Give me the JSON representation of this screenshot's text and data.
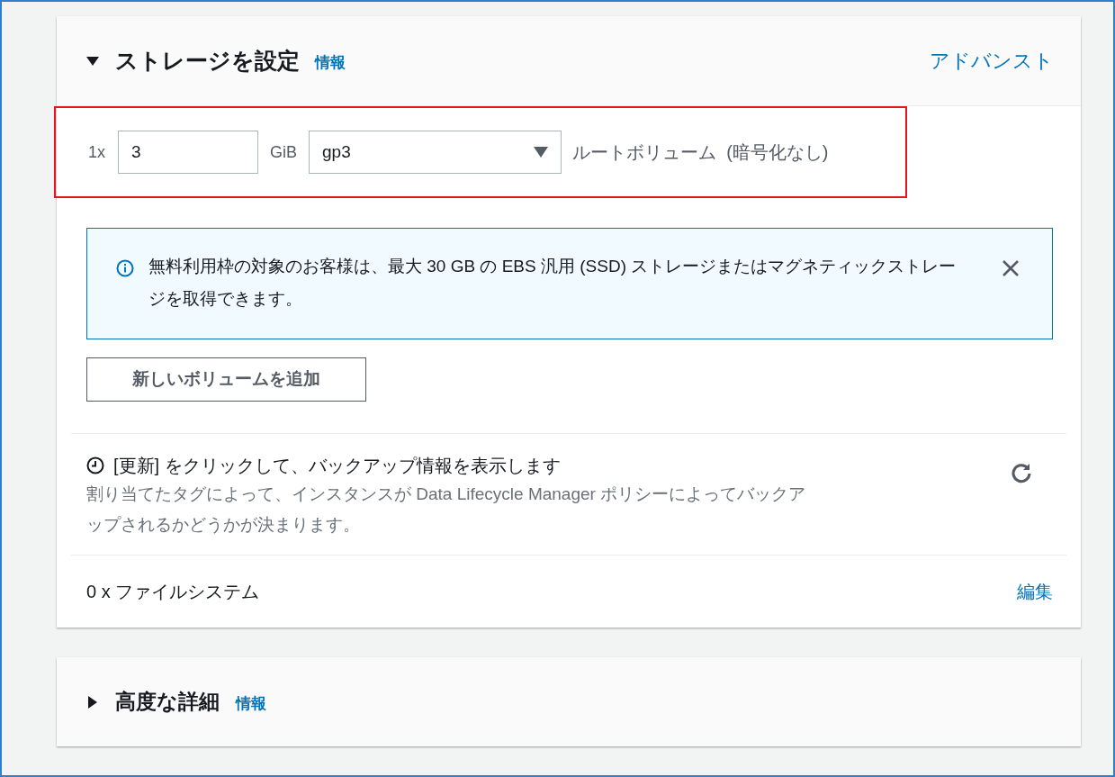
{
  "storage_panel": {
    "expanded": true,
    "title": "ストレージを設定",
    "info_link": "情報",
    "advanced_link": "アドバンスト",
    "volume": {
      "highlighted": true,
      "count": "1x",
      "size": "3",
      "unit": "GiB",
      "type": "gp3",
      "description": "ルートボリューム  (暗号化なし)"
    },
    "alert": {
      "text": "無料利用枠の対象のお客様は、最大 30 GB の EBS 汎用 (SSD) ストレージまたはマグネティックストレージを取得できます。"
    },
    "add_volume_button": "新しいボリュームを追加",
    "backup": {
      "title": "[更新] をクリックして、バックアップ情報を表示します",
      "description": "割り当てたタグによって、インスタンスが Data Lifecycle Manager ポリシーによってバックアップされるかどうかが決まります。"
    },
    "file_systems": {
      "label": "0 x ファイルシステム",
      "edit_link": "編集"
    }
  },
  "advanced_panel": {
    "expanded": false,
    "title": "高度な詳細",
    "info_link": "情報"
  }
}
